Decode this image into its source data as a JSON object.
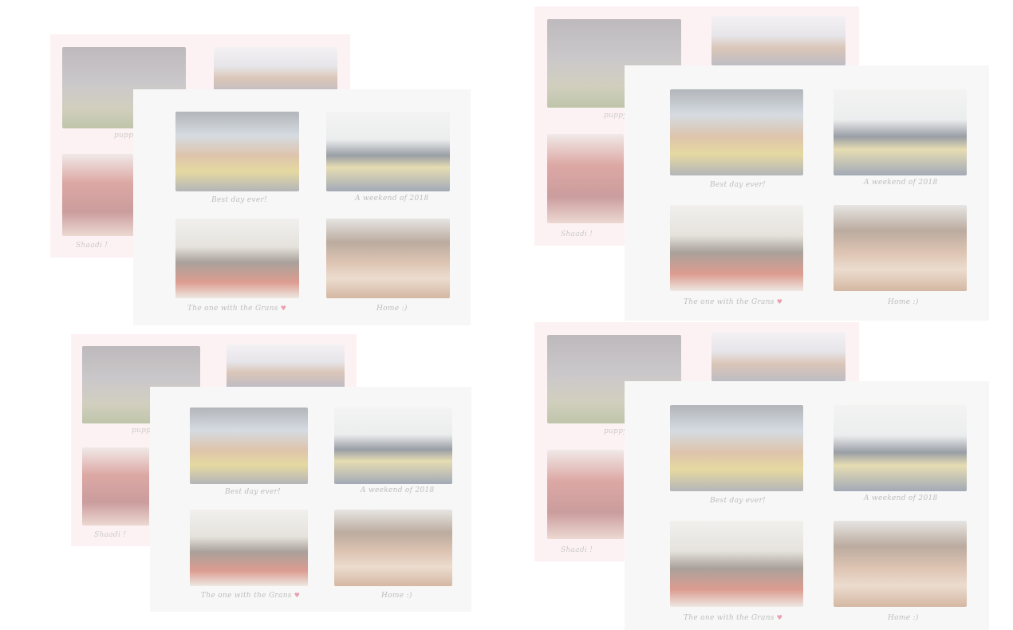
{
  "layouts": [
    {
      "back_captions": {
        "c1": "puppy",
        "c2": "Shaadi !"
      },
      "front_captions": {
        "c1": "Best day ever!",
        "c2": "A weekend of 2018",
        "c3": "The one with the Grans",
        "c4": "Home :)"
      }
    },
    {
      "back_captions": {
        "c1": "puppy",
        "c2": "Shaadi !"
      },
      "front_captions": {
        "c1": "Best day ever!",
        "c2": "A weekend of 2018",
        "c3": "The one with the Grans",
        "c4": "Home :)"
      }
    },
    {
      "back_captions": {
        "c1": "puppy",
        "c2": "Shaadi !"
      },
      "front_captions": {
        "c1": "Best day ever!",
        "c2": "A weekend of 2018",
        "c3": "The one with the Grans",
        "c4": "Home :)"
      }
    },
    {
      "back_captions": {
        "c1": "puppy",
        "c2": "Shaadi !"
      },
      "front_captions": {
        "c1": "Best day ever!",
        "c2": "A weekend of 2018",
        "c3": "The one with the Grans",
        "c4": "Home :)"
      }
    }
  ],
  "heart_icon": "heart-icon",
  "colors": {
    "back_page": "#fdf0f1",
    "front_page": "#f7f7f7",
    "caption": "#bdbdbd",
    "heart": "#e8a0b0"
  }
}
